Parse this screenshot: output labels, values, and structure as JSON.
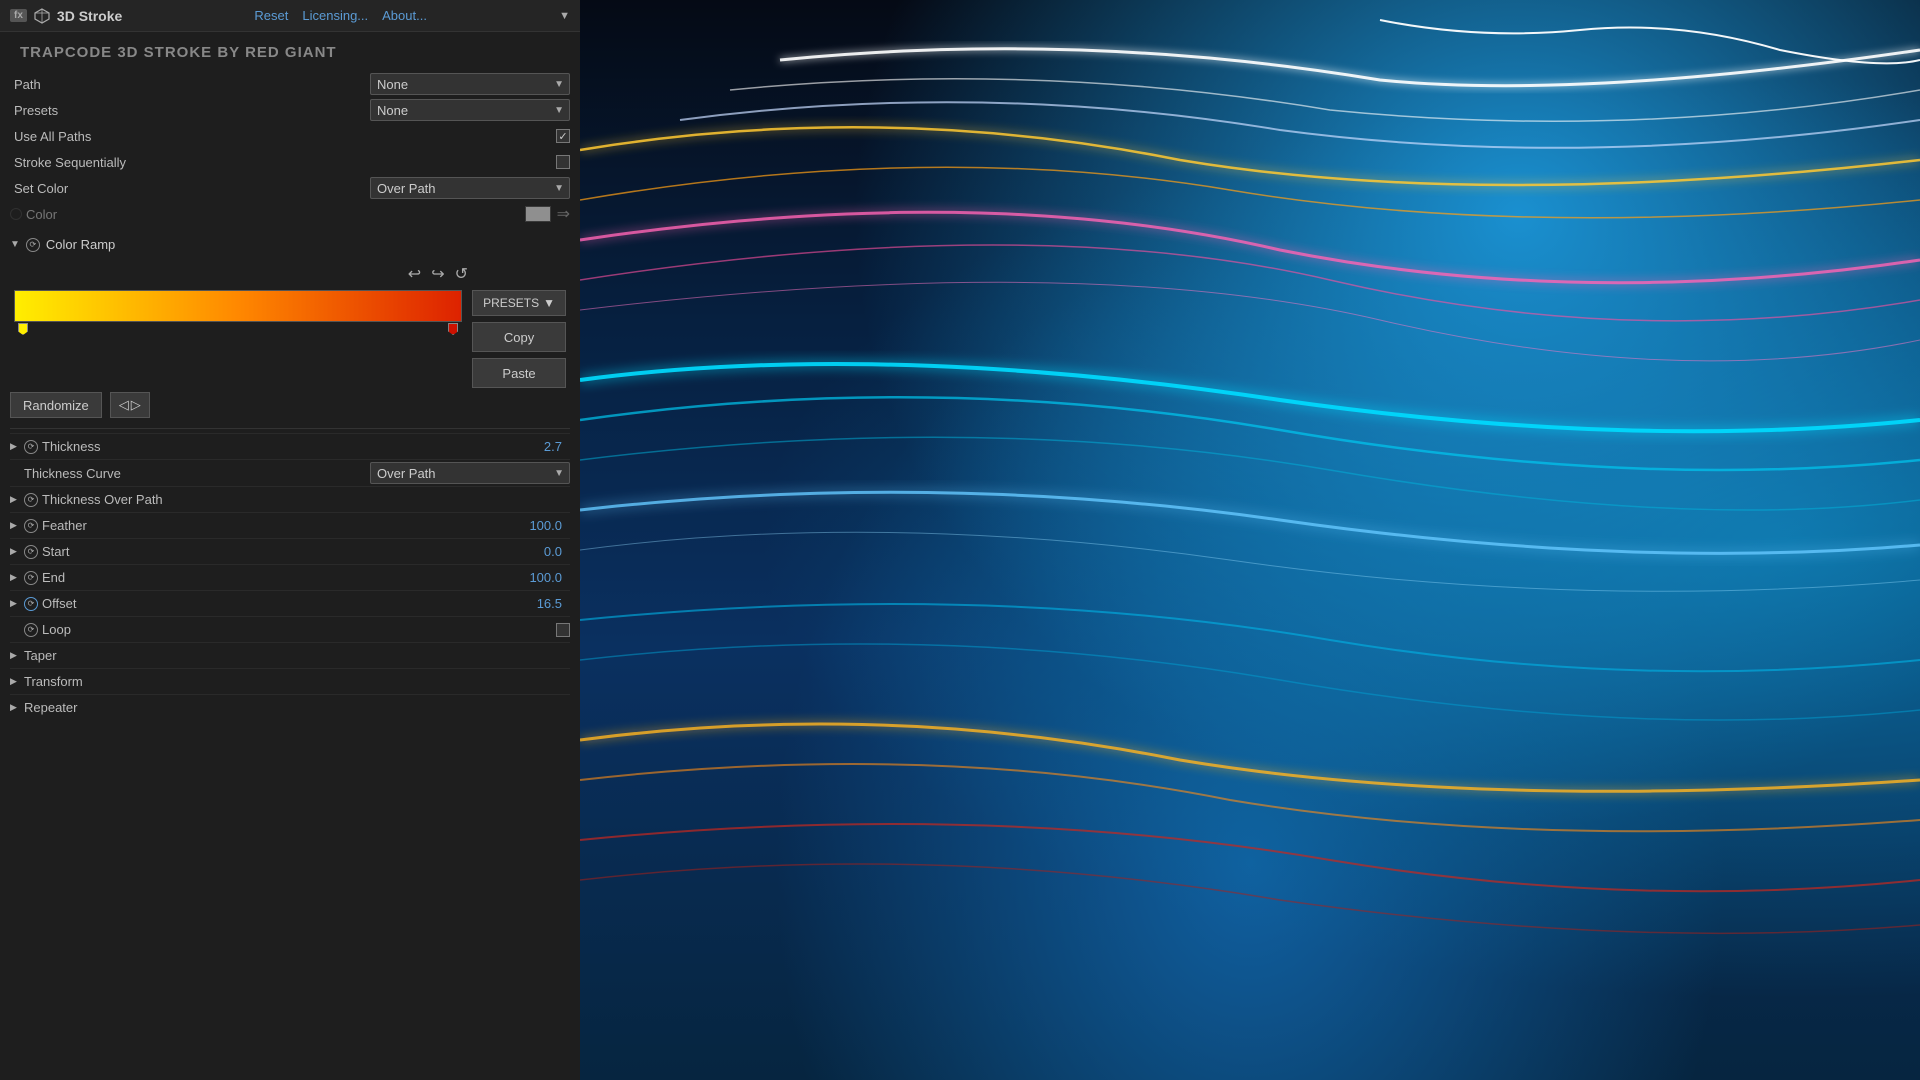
{
  "header": {
    "fx_label": "fx",
    "title": "3D Stroke",
    "reset_label": "Reset",
    "licensing_label": "Licensing...",
    "about_label": "About..."
  },
  "subtitle": "TRAPCODE 3D STROKE BY RED GIANT",
  "path_row": {
    "label": "Path",
    "value": "None"
  },
  "presets_row": {
    "label": "Presets",
    "value": "None"
  },
  "use_all_paths": {
    "label": "Use All Paths",
    "checked": true
  },
  "stroke_sequentially": {
    "label": "Stroke Sequentially",
    "checked": false
  },
  "set_color": {
    "label": "Set Color",
    "value": "Over Path"
  },
  "color_row": {
    "label": "Color",
    "disabled": true
  },
  "color_ramp": {
    "label": "Color Ramp",
    "undo_icon": "↩",
    "redo_icon": "↪",
    "reset_icon": "↺",
    "presets_label": "PRESETS",
    "copy_label": "Copy",
    "paste_label": "Paste",
    "randomize_label": "Randomize"
  },
  "params": {
    "thickness": {
      "label": "Thickness",
      "value": "2.7"
    },
    "thickness_curve": {
      "label": "Thickness Curve",
      "value": "Over Path"
    },
    "thickness_over_path": {
      "label": "Thickness Over Path"
    },
    "feather": {
      "label": "Feather",
      "value": "100.0"
    },
    "start": {
      "label": "Start",
      "value": "0.0"
    },
    "end": {
      "label": "End",
      "value": "100.0"
    },
    "offset": {
      "label": "Offset",
      "value": "16.5"
    },
    "loop": {
      "label": "Loop",
      "checked": false
    },
    "taper": {
      "label": "Taper"
    },
    "transform": {
      "label": "Transform"
    },
    "repeater": {
      "label": "Repeater"
    }
  },
  "colors": {
    "accent_blue": "#5b9bd5",
    "bg_panel": "#1e1e1e",
    "bg_header": "#252525",
    "gradient_start": "#ffee00",
    "gradient_mid": "#ff8800",
    "gradient_end": "#dd2200"
  }
}
